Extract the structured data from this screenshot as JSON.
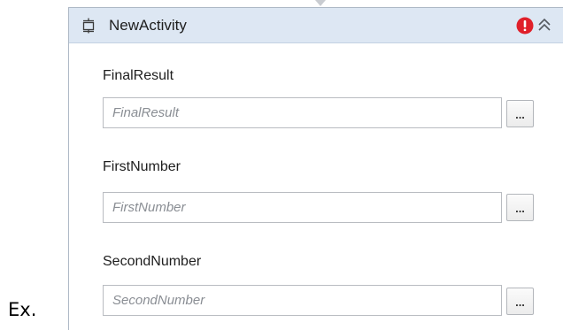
{
  "activity": {
    "title": "NewActivity",
    "icon": "activity-icon",
    "status_icon": "error-icon",
    "collapse_icon": "chevron-up-icon",
    "header_color": "#dde7f3",
    "error_color": "#e0202a"
  },
  "fields": [
    {
      "label": "FinalResult",
      "value": "",
      "placeholder": "FinalResult",
      "browse_label": "..."
    },
    {
      "label": "FirstNumber",
      "value": "",
      "placeholder": "FirstNumber",
      "browse_label": "..."
    },
    {
      "label": "SecondNumber",
      "value": "",
      "placeholder": "SecondNumber",
      "browse_label": "..."
    }
  ],
  "annotation": {
    "text": "Ex."
  }
}
